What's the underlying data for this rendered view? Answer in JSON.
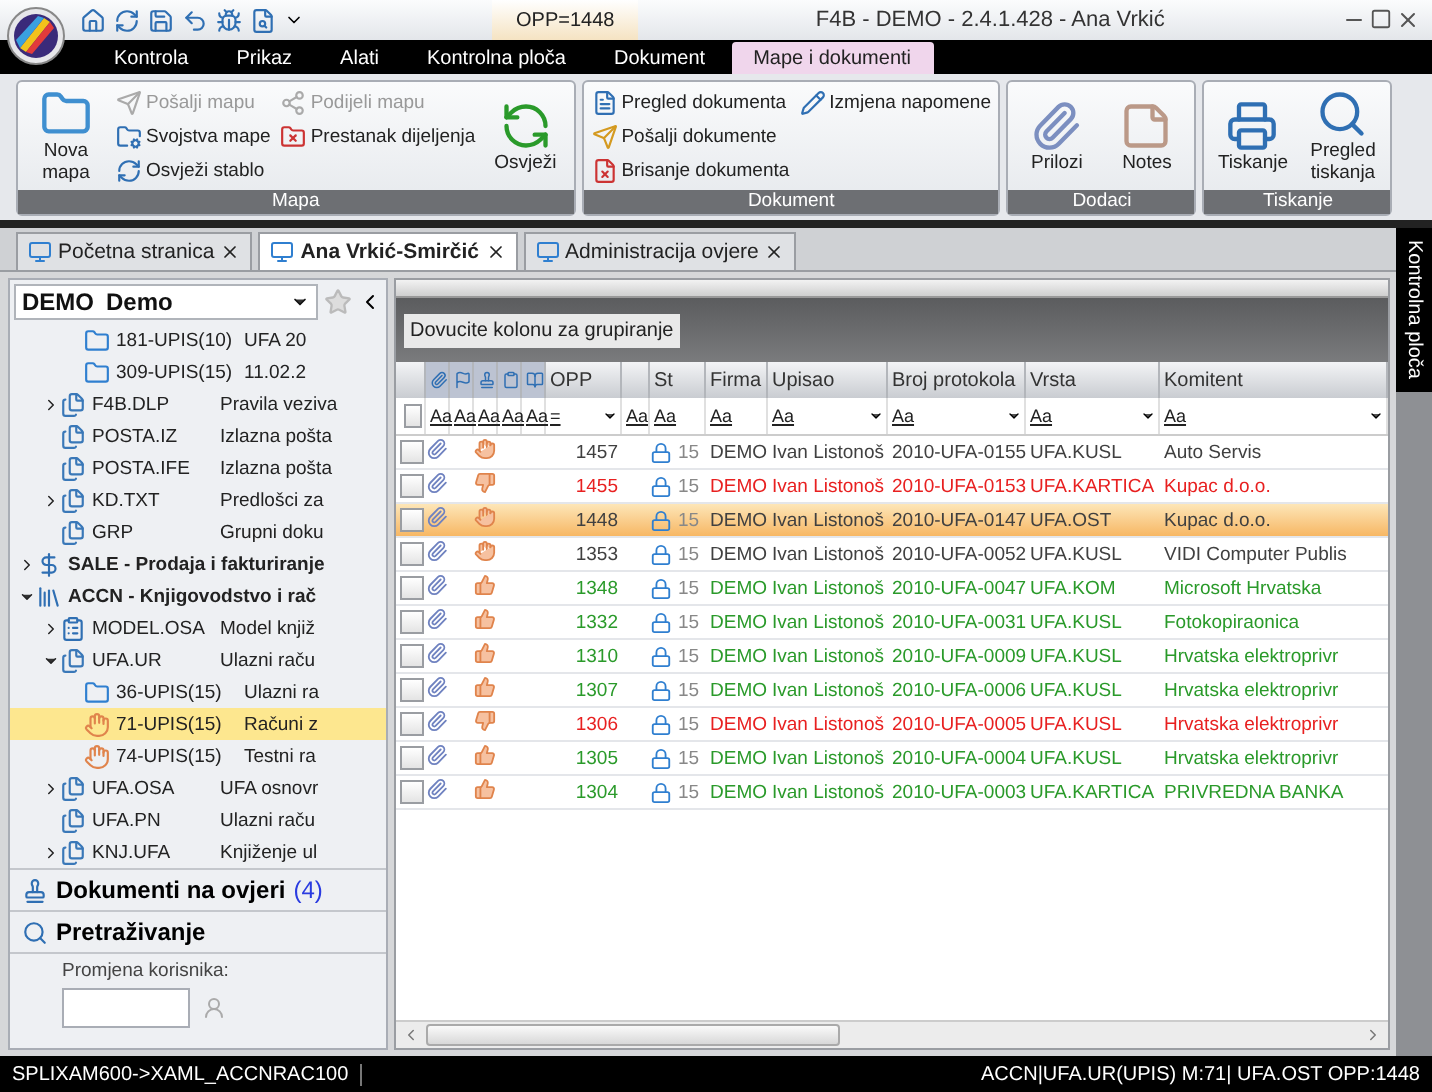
{
  "title_bar": {
    "context_tab": "OPP=1448",
    "title": "F4B - DEMO - 2.4.1.428 - Ana  Vrkić"
  },
  "ribbon": {
    "tabs": [
      {
        "label": "Kontrola",
        "selected": false
      },
      {
        "label": "Prikaz",
        "selected": false
      },
      {
        "label": "Alati",
        "selected": false
      },
      {
        "label": "Kontrolna ploča",
        "selected": false
      },
      {
        "label": "Dokument",
        "selected": false
      },
      {
        "label": "Mape i dokumenti",
        "selected": true
      }
    ],
    "groups": [
      {
        "label": "Mapa",
        "columns": [
          [
            {
              "kind": "large",
              "label": "Nova mapa",
              "disabled": false
            }
          ],
          [
            {
              "kind": "small",
              "label": "Pošalji mapu",
              "disabled": true
            },
            {
              "kind": "small",
              "label": "Svojstva mape",
              "disabled": false
            },
            {
              "kind": "small",
              "label": "Osvježi stablo",
              "disabled": false
            }
          ],
          [
            {
              "kind": "small",
              "label": "Podijeli mapu",
              "disabled": true
            },
            {
              "kind": "small",
              "label": "Prestanak dijeljenja",
              "disabled": false
            }
          ],
          [
            {
              "kind": "large",
              "label": "Osvježi",
              "disabled": false
            }
          ]
        ]
      },
      {
        "label": "Dokument",
        "columns": [
          [
            {
              "kind": "small",
              "label": "Pregled dokumenta",
              "disabled": false
            },
            {
              "kind": "small",
              "label": "Pošalji dokumente",
              "disabled": false
            },
            {
              "kind": "small",
              "label": "Brisanje dokumenta",
              "disabled": false
            }
          ],
          [
            {
              "kind": "small",
              "label": "Izmjena napomene",
              "disabled": false
            }
          ]
        ]
      },
      {
        "label": "Dodaci",
        "columns": [
          [
            {
              "kind": "large",
              "label": "Prilozi",
              "disabled": false
            }
          ],
          [
            {
              "kind": "large",
              "label": "Notes",
              "disabled": false
            }
          ]
        ]
      },
      {
        "label": "Tiskanje",
        "columns": [
          [
            {
              "kind": "large",
              "label": "Tiskanje",
              "disabled": false
            }
          ],
          [
            {
              "kind": "large",
              "label": "Pregled tiskanja",
              "disabled": false
            }
          ]
        ]
      }
    ]
  },
  "doc_tabs": [
    {
      "label": "Početna stranica",
      "selected": false
    },
    {
      "label": "Ana Vrkić-Smirčić",
      "selected": true
    },
    {
      "label": "Administracija ovjere",
      "selected": false
    }
  ],
  "side_panel_tab": "Kontrolna ploča",
  "company_selector": {
    "code": "DEMO",
    "name": "Demo"
  },
  "tree": [
    {
      "children": [
        {
          "children": [
            {
              "kind": "folder",
              "code": "181-UPIS(10)",
              "description": "UFA 20",
              "selected": false
            },
            {
              "kind": "folder",
              "code": "309-UPIS(15)",
              "description": "11.02.2",
              "selected": false
            }
          ]
        },
        {
          "kind": "files",
          "code": "F4B.DLP",
          "description": "Pravila veziva",
          "expanded": false,
          "selected": false
        },
        {
          "kind": "files",
          "code": "POSTA.IZ",
          "description": "Izlazna pošta",
          "selected": false
        },
        {
          "kind": "files",
          "code": "POSTA.IFE",
          "description": "Izlazna pošta",
          "selected": false
        },
        {
          "kind": "files",
          "code": "KD.TXT",
          "description": "Predlošci za",
          "expanded": false,
          "selected": false
        },
        {
          "kind": "files",
          "code": "GRP",
          "description": "Grupni doku",
          "selected": false
        }
      ]
    },
    {
      "kind": "sale",
      "code": "SALE - Prodaja i fakturiranje",
      "bold": true,
      "expanded": false,
      "selected": false
    },
    {
      "kind": "ledger",
      "code": "ACCN - Knjigovodstvo i rač",
      "bold": true,
      "expanded": true,
      "selected": false,
      "children": [
        {
          "kind": "form",
          "code": "MODEL.OSA",
          "description": "Model knjiž",
          "expanded": false,
          "selected": false
        },
        {
          "kind": "files",
          "code": "UFA.UR",
          "description": "Ulazni raču",
          "expanded": true,
          "selected": false,
          "children": [
            {
              "kind": "folder",
              "code": "36-UPIS(15)",
              "description": "Ulazni ra",
              "selected": false
            },
            {
              "kind": "approval",
              "code": "71-UPIS(15)",
              "description": "Računi z",
              "selected": true
            },
            {
              "kind": "approval",
              "code": "74-UPIS(15)",
              "description": "Testni ra",
              "selected": false
            }
          ]
        },
        {
          "kind": "files",
          "code": "UFA.OSA",
          "description": "UFA osnovr",
          "expanded": false,
          "selected": false
        },
        {
          "kind": "files",
          "code": "UFA.PN",
          "description": "Ulazni raču",
          "selected": false
        },
        {
          "kind": "files",
          "code": "KNJ.UFA",
          "description": "Knjiženje ul",
          "expanded": false,
          "selected": false
        }
      ]
    }
  ],
  "sections": [
    {
      "label": "Dokumenti na ovjeri",
      "count": "(4)"
    },
    {
      "label": "Pretraživanje"
    }
  ],
  "user_change": {
    "label": "Promjena korisnika:"
  },
  "grid": {
    "group_panel_hint": "Dovucite kolonu za grupiranje",
    "columns": [
      {
        "kind": "select",
        "checked": false
      },
      {
        "kind": "icon",
        "filter": "Aa"
      },
      {
        "kind": "icon",
        "filter": "Aa"
      },
      {
        "kind": "icon",
        "filter": "Aa"
      },
      {
        "kind": "icon",
        "filter": "Aa"
      },
      {
        "kind": "icon",
        "filter": "Aa"
      },
      {
        "kind": "text",
        "label": "OPP",
        "filter": "=",
        "dropdown": true
      },
      {
        "kind": "text",
        "filter": "Aa"
      },
      {
        "kind": "text",
        "label": "St",
        "filter": "Aa"
      },
      {
        "kind": "text",
        "label": "Firma",
        "filter": "Aa"
      },
      {
        "kind": "text",
        "label": "Upisao",
        "filter": "Aa",
        "dropdown": true
      },
      {
        "kind": "text",
        "label": "Broj protokola",
        "filter": "Aa",
        "dropdown": true
      },
      {
        "kind": "text",
        "label": "Vrsta",
        "filter": "Aa",
        "dropdown": true
      },
      {
        "kind": "text",
        "label": "Komitent",
        "filter": "Aa",
        "dropdown": true
      }
    ],
    "rows": [
      {
        "checked": false,
        "kind": "pending",
        "opp": "1457",
        "st": "15",
        "firma": "DEMO",
        "upisao": "Ivan Listonoš",
        "broj": "2010-UFA-0155",
        "vrsta": "UFA.KUSL",
        "komitent": "Auto Servis",
        "color": "#404040",
        "selected": false
      },
      {
        "checked": false,
        "kind": "down",
        "opp": "1455",
        "st": "15",
        "firma": "DEMO",
        "upisao": "Ivan Listonoš",
        "broj": "2010-UFA-0153",
        "vrsta": "UFA.KARTICA",
        "komitent": "Kupac d.o.o.",
        "color": "#e82020",
        "selected": false
      },
      {
        "checked": false,
        "kind": "pending",
        "opp": "1448",
        "st": "15",
        "firma": "DEMO",
        "upisao": "Ivan Listonoš",
        "broj": "2010-UFA-0147",
        "vrsta": "UFA.OST",
        "komitent": "Kupac d.o.o.",
        "color": "#404040",
        "selected": true
      },
      {
        "checked": false,
        "kind": "pending",
        "opp": "1353",
        "st": "15",
        "firma": "DEMO",
        "upisao": "Ivan Listonoš",
        "broj": "2010-UFA-0052",
        "vrsta": "UFA.KUSL",
        "komitent": "VIDI Computer Publis",
        "color": "#404040",
        "selected": false
      },
      {
        "checked": false,
        "kind": "up",
        "opp": "1348",
        "st": "15",
        "firma": "DEMO",
        "upisao": "Ivan Listonoš",
        "broj": "2010-UFA-0047",
        "vrsta": "UFA.KOM",
        "komitent": "Microsoft Hrvatska",
        "color": "#2a9a2a",
        "selected": false
      },
      {
        "checked": false,
        "kind": "up",
        "opp": "1332",
        "st": "15",
        "firma": "DEMO",
        "upisao": "Ivan Listonoš",
        "broj": "2010-UFA-0031",
        "vrsta": "UFA.KUSL",
        "komitent": "Fotokopiraonica",
        "color": "#2a9a2a",
        "selected": false
      },
      {
        "checked": false,
        "kind": "up",
        "opp": "1310",
        "st": "15",
        "firma": "DEMO",
        "upisao": "Ivan Listonoš",
        "broj": "2010-UFA-0009",
        "vrsta": "UFA.KUSL",
        "komitent": "Hrvatska elektroprivr",
        "color": "#2a9a2a",
        "selected": false
      },
      {
        "checked": false,
        "kind": "up",
        "opp": "1307",
        "st": "15",
        "firma": "DEMO",
        "upisao": "Ivan Listonoš",
        "broj": "2010-UFA-0006",
        "vrsta": "UFA.KUSL",
        "komitent": "Hrvatska elektroprivr",
        "color": "#2a9a2a",
        "selected": false
      },
      {
        "checked": false,
        "kind": "down",
        "opp": "1306",
        "st": "15",
        "firma": "DEMO",
        "upisao": "Ivan Listonoš",
        "broj": "2010-UFA-0005",
        "vrsta": "UFA.KUSL",
        "komitent": "Hrvatska elektroprivr",
        "color": "#e82020",
        "selected": false
      },
      {
        "checked": false,
        "kind": "up",
        "opp": "1305",
        "st": "15",
        "firma": "DEMO",
        "upisao": "Ivan Listonoš",
        "broj": "2010-UFA-0004",
        "vrsta": "UFA.KUSL",
        "komitent": "Hrvatska elektroprivr",
        "color": "#2a9a2a",
        "selected": false
      },
      {
        "checked": false,
        "kind": "up",
        "opp": "1304",
        "st": "15",
        "firma": "DEMO",
        "upisao": "Ivan Listonoš",
        "broj": "2010-UFA-0003",
        "vrsta": "UFA.KARTICA",
        "komitent": "PRIVREDNA BANKA",
        "color": "#2a9a2a",
        "selected": false
      }
    ]
  },
  "status_bar": {
    "left": "SPLIXAM600->XAML_ACCNRAC100",
    "right": "ACCN|UFA.UR(UPIS) M:71| UFA.OST OPP:1448"
  }
}
